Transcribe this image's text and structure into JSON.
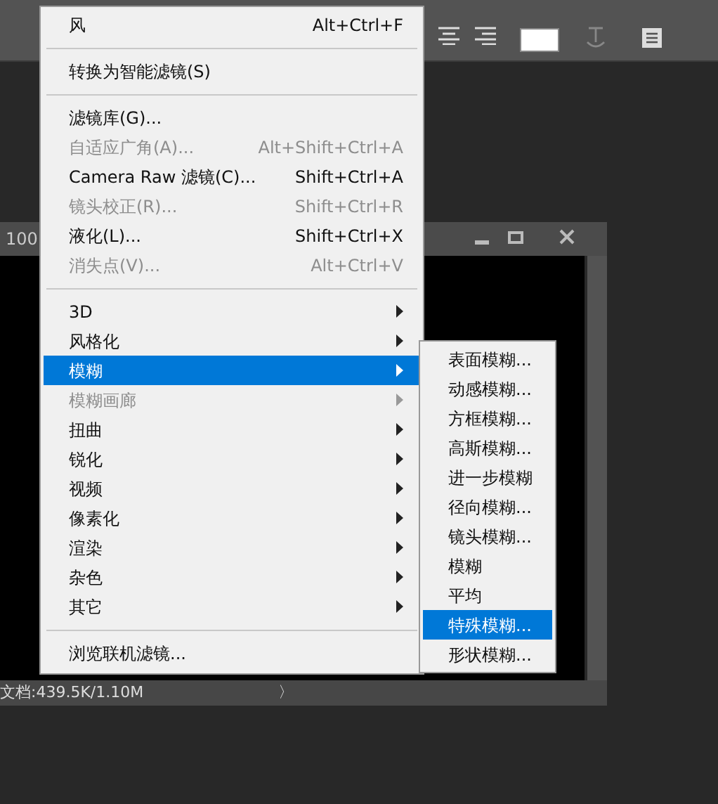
{
  "document": {
    "zoom": "100",
    "status": "文档:439.5K/1.10M",
    "status_arrow": "〉"
  },
  "filter_menu": {
    "items": [
      {
        "kind": "item",
        "label": "风",
        "shortcut": "Alt+Ctrl+F",
        "disabled": false,
        "selected": false
      },
      {
        "kind": "separator"
      },
      {
        "kind": "item",
        "label": "转换为智能滤镜(S)",
        "disabled": false,
        "selected": false
      },
      {
        "kind": "separator"
      },
      {
        "kind": "item",
        "label": "滤镜库(G)...",
        "disabled": false,
        "selected": false
      },
      {
        "kind": "item",
        "label": "自适应广角(A)...",
        "shortcut": "Alt+Shift+Ctrl+A",
        "disabled": true,
        "selected": false
      },
      {
        "kind": "item",
        "label": "Camera Raw 滤镜(C)...",
        "shortcut": "Shift+Ctrl+A",
        "disabled": false,
        "selected": false
      },
      {
        "kind": "item",
        "label": "镜头校正(R)...",
        "shortcut": "Shift+Ctrl+R",
        "disabled": true,
        "selected": false
      },
      {
        "kind": "item",
        "label": "液化(L)...",
        "shortcut": "Shift+Ctrl+X",
        "disabled": false,
        "selected": false
      },
      {
        "kind": "item",
        "label": "消失点(V)...",
        "shortcut": "Alt+Ctrl+V",
        "disabled": true,
        "selected": false
      },
      {
        "kind": "separator"
      },
      {
        "kind": "submenu",
        "label": "3D",
        "disabled": false,
        "selected": false
      },
      {
        "kind": "submenu",
        "label": "风格化",
        "disabled": false,
        "selected": false
      },
      {
        "kind": "submenu",
        "label": "模糊",
        "disabled": false,
        "selected": true
      },
      {
        "kind": "submenu",
        "label": "模糊画廊",
        "disabled": true,
        "selected": false
      },
      {
        "kind": "submenu",
        "label": "扭曲",
        "disabled": false,
        "selected": false
      },
      {
        "kind": "submenu",
        "label": "锐化",
        "disabled": false,
        "selected": false
      },
      {
        "kind": "submenu",
        "label": "视频",
        "disabled": false,
        "selected": false
      },
      {
        "kind": "submenu",
        "label": "像素化",
        "disabled": false,
        "selected": false
      },
      {
        "kind": "submenu",
        "label": "渲染",
        "disabled": false,
        "selected": false
      },
      {
        "kind": "submenu",
        "label": "杂色",
        "disabled": false,
        "selected": false
      },
      {
        "kind": "submenu",
        "label": "其它",
        "disabled": false,
        "selected": false
      },
      {
        "kind": "separator"
      },
      {
        "kind": "item",
        "label": "浏览联机滤镜...",
        "disabled": false,
        "selected": false
      }
    ]
  },
  "blur_submenu": {
    "items": [
      {
        "label": "表面模糊...",
        "selected": false
      },
      {
        "label": "动感模糊...",
        "selected": false
      },
      {
        "label": "方框模糊...",
        "selected": false
      },
      {
        "label": "高斯模糊...",
        "selected": false
      },
      {
        "label": "进一步模糊",
        "selected": false
      },
      {
        "label": "径向模糊...",
        "selected": false
      },
      {
        "label": "镜头模糊...",
        "selected": false
      },
      {
        "label": "模糊",
        "selected": false
      },
      {
        "label": "平均",
        "selected": false
      },
      {
        "label": "特殊模糊...",
        "selected": true
      },
      {
        "label": "形状模糊...",
        "selected": false
      }
    ]
  }
}
